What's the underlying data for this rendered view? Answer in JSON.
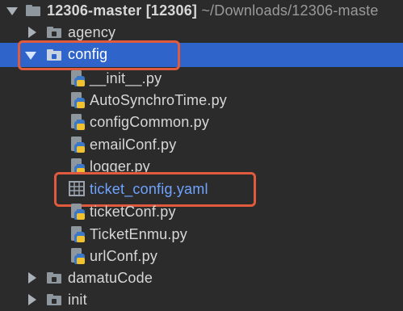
{
  "project": {
    "name": "12306-master",
    "module": "[12306]",
    "path": "~/Downloads/12306-maste"
  },
  "tree": {
    "folders": {
      "agency": "agency",
      "config": "config",
      "damatuCode": "damatuCode",
      "init": "init"
    },
    "config_files": [
      "__init__.py",
      "AutoSynchroTime.py",
      "configCommon.py",
      "emailConf.py",
      "logger.py",
      "ticket_config.yaml",
      "ticketConf.py",
      "TicketEnmu.py",
      "urlConf.py"
    ]
  },
  "colors": {
    "background": "#2b2b2b",
    "selection": "#2f65ca",
    "highlight_box": "#e05a3d",
    "yaml_text": "#6fa3ff"
  }
}
